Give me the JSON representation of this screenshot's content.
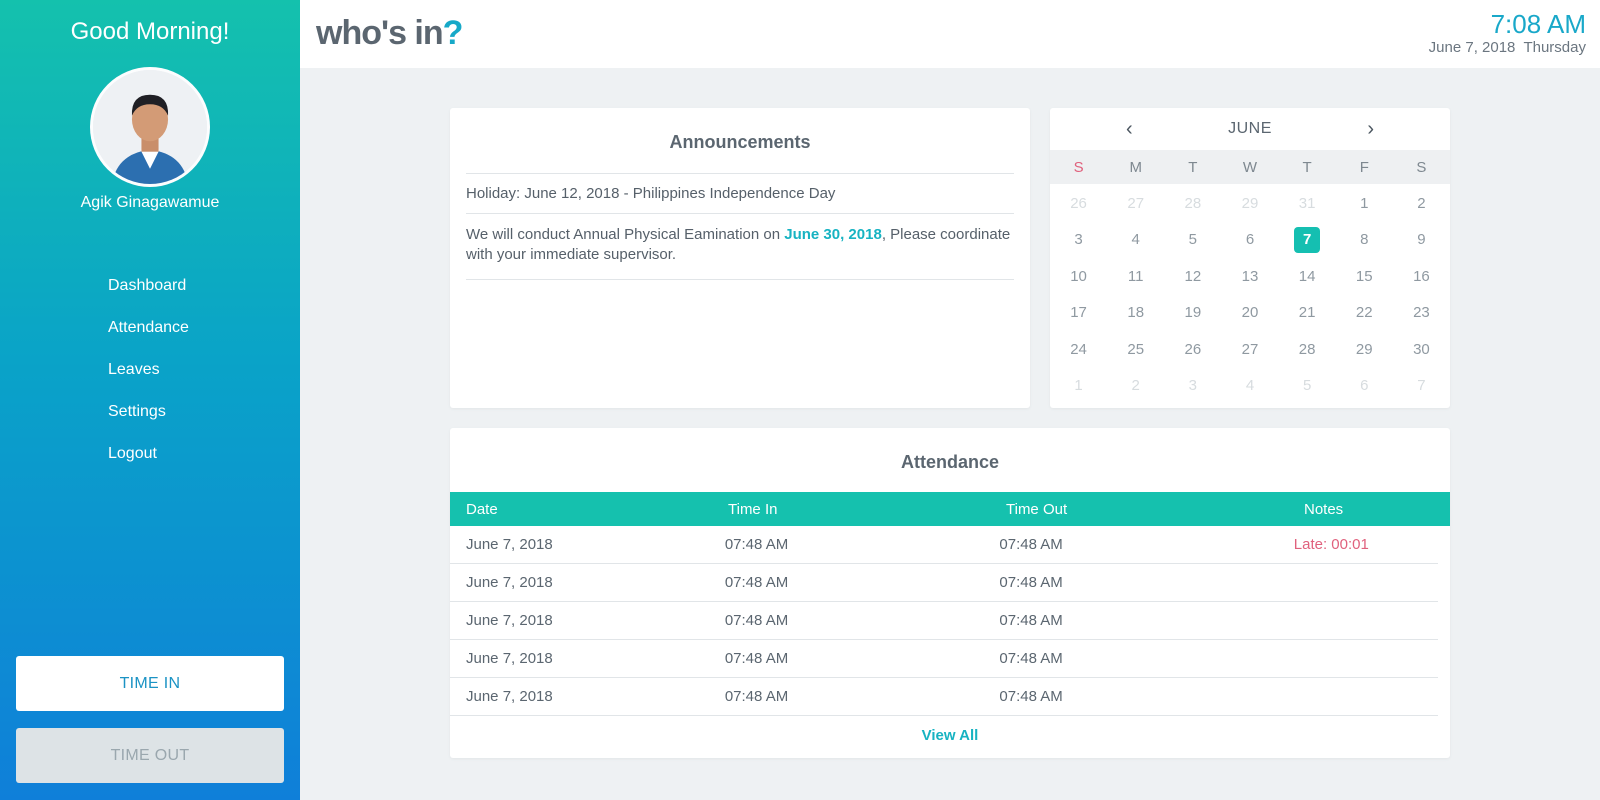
{
  "sidebar": {
    "greeting": "Good Morning!",
    "user_name": "Agik Ginagawamue",
    "nav": [
      "Dashboard",
      "Attendance",
      "Leaves",
      "Settings",
      "Logout"
    ],
    "time_in_label": "TIME IN",
    "time_out_label": "TIME OUT"
  },
  "header": {
    "logo_text": "who's in",
    "logo_mark": "?",
    "time": "7:08 AM",
    "date": "June 7, 2018  Thursday"
  },
  "announcements": {
    "title": "Announcements",
    "items": [
      {
        "text": "Holiday: June 12, 2018 - Philippines Independence Day"
      },
      {
        "before": "We will conduct Annual Physical Eamination on ",
        "highlight": "June 30, 2018",
        "after": ", Please coordinate with your immediate supervisor."
      }
    ]
  },
  "calendar": {
    "month": "JUNE",
    "weekdays": [
      "S",
      "M",
      "T",
      "W",
      "T",
      "F",
      "S"
    ],
    "selected_day": "7",
    "weeks": [
      [
        "26",
        "27",
        "28",
        "29",
        "31",
        "1",
        "2"
      ],
      [
        "3",
        "4",
        "5",
        "6",
        "7",
        "8",
        "9"
      ],
      [
        "10",
        "11",
        "12",
        "13",
        "14",
        "15",
        "16"
      ],
      [
        "17",
        "18",
        "19",
        "20",
        "21",
        "22",
        "23"
      ],
      [
        "24",
        "25",
        "26",
        "27",
        "28",
        "29",
        "30"
      ],
      [
        "1",
        "2",
        "3",
        "4",
        "5",
        "6",
        "7"
      ]
    ]
  },
  "attendance": {
    "title": "Attendance",
    "columns": [
      "Date",
      "Time In",
      "Time Out",
      "Notes"
    ],
    "rows": [
      [
        "June 7, 2018",
        "07:48 AM",
        "07:48 AM",
        "Late: 00:01"
      ],
      [
        "June 7, 2018",
        "07:48 AM",
        "07:48 AM",
        ""
      ],
      [
        "June 7, 2018",
        "07:48 AM",
        "07:48 AM",
        ""
      ],
      [
        "June 7, 2018",
        "07:48 AM",
        "07:48 AM",
        ""
      ],
      [
        "June 7, 2018",
        "07:48 AM",
        "07:48 AM",
        ""
      ]
    ],
    "view_all": "View All"
  },
  "colors": {
    "accent": "#15c1ae",
    "accent_blue": "#17a9c8",
    "late": "#e0617d"
  }
}
